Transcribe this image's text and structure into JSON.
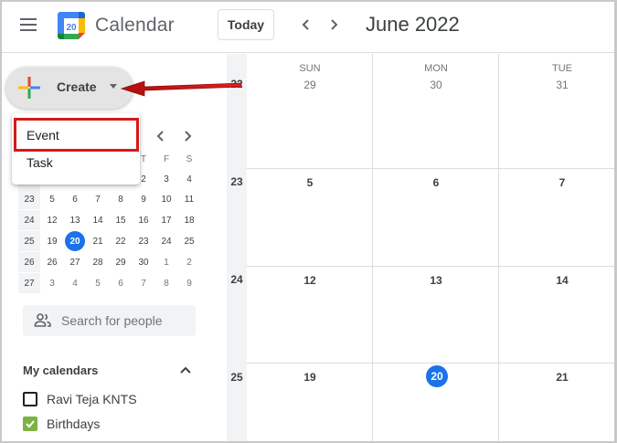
{
  "header": {
    "menu_icon": "hamburger-menu-icon",
    "logo_number": "20",
    "app_name": "Calendar",
    "today_label": "Today",
    "prev_icon": "chevron-left-icon",
    "next_icon": "chevron-right-icon",
    "title": "June 2022"
  },
  "sidebar": {
    "create_label": "Create",
    "create_icon": "plus-multicolor-icon",
    "dropdown": {
      "items": [
        {
          "label": "Event"
        },
        {
          "label": "Task"
        }
      ]
    },
    "mini_calendar": {
      "visible_day_headers": [
        "T",
        "F",
        "S"
      ],
      "rows": [
        {
          "week": "",
          "days": [
            "",
            "",
            "",
            "",
            "2",
            "3",
            "4"
          ]
        },
        {
          "week": "23",
          "days": [
            "5",
            "6",
            "7",
            "8",
            "9",
            "10",
            "11"
          ]
        },
        {
          "week": "24",
          "days": [
            "12",
            "13",
            "14",
            "15",
            "16",
            "17",
            "18"
          ]
        },
        {
          "week": "25",
          "days": [
            "19",
            "20",
            "21",
            "22",
            "23",
            "24",
            "25"
          ]
        },
        {
          "week": "26",
          "days": [
            "26",
            "27",
            "28",
            "29",
            "30",
            "1",
            "2"
          ]
        },
        {
          "week": "27",
          "days": [
            "3",
            "4",
            "5",
            "6",
            "7",
            "8",
            "9"
          ]
        }
      ],
      "today": "20"
    },
    "search_people": {
      "placeholder": "Search for people",
      "icon": "people-icon"
    },
    "my_calendars": {
      "title": "My calendars",
      "toggle_icon": "chevron-up-icon",
      "items": [
        {
          "label": "Ravi Teja KNTS",
          "checked": false,
          "color": "#202124"
        },
        {
          "label": "Birthdays",
          "checked": true,
          "color": "#7cb342"
        }
      ]
    }
  },
  "main": {
    "columns": [
      {
        "dow": "SUN"
      },
      {
        "dow": "MON"
      },
      {
        "dow": "TUE"
      }
    ],
    "weeks": [
      {
        "week": "22",
        "dates": [
          "29",
          "30",
          "31"
        ]
      },
      {
        "week": "23",
        "dates": [
          "5",
          "6",
          "7"
        ]
      },
      {
        "week": "24",
        "dates": [
          "12",
          "13",
          "14"
        ]
      },
      {
        "week": "25",
        "dates": [
          "19",
          "20",
          "21"
        ]
      }
    ],
    "today": "20"
  },
  "colors": {
    "accent": "#1a73e8",
    "annotation": "#d11a1a"
  }
}
